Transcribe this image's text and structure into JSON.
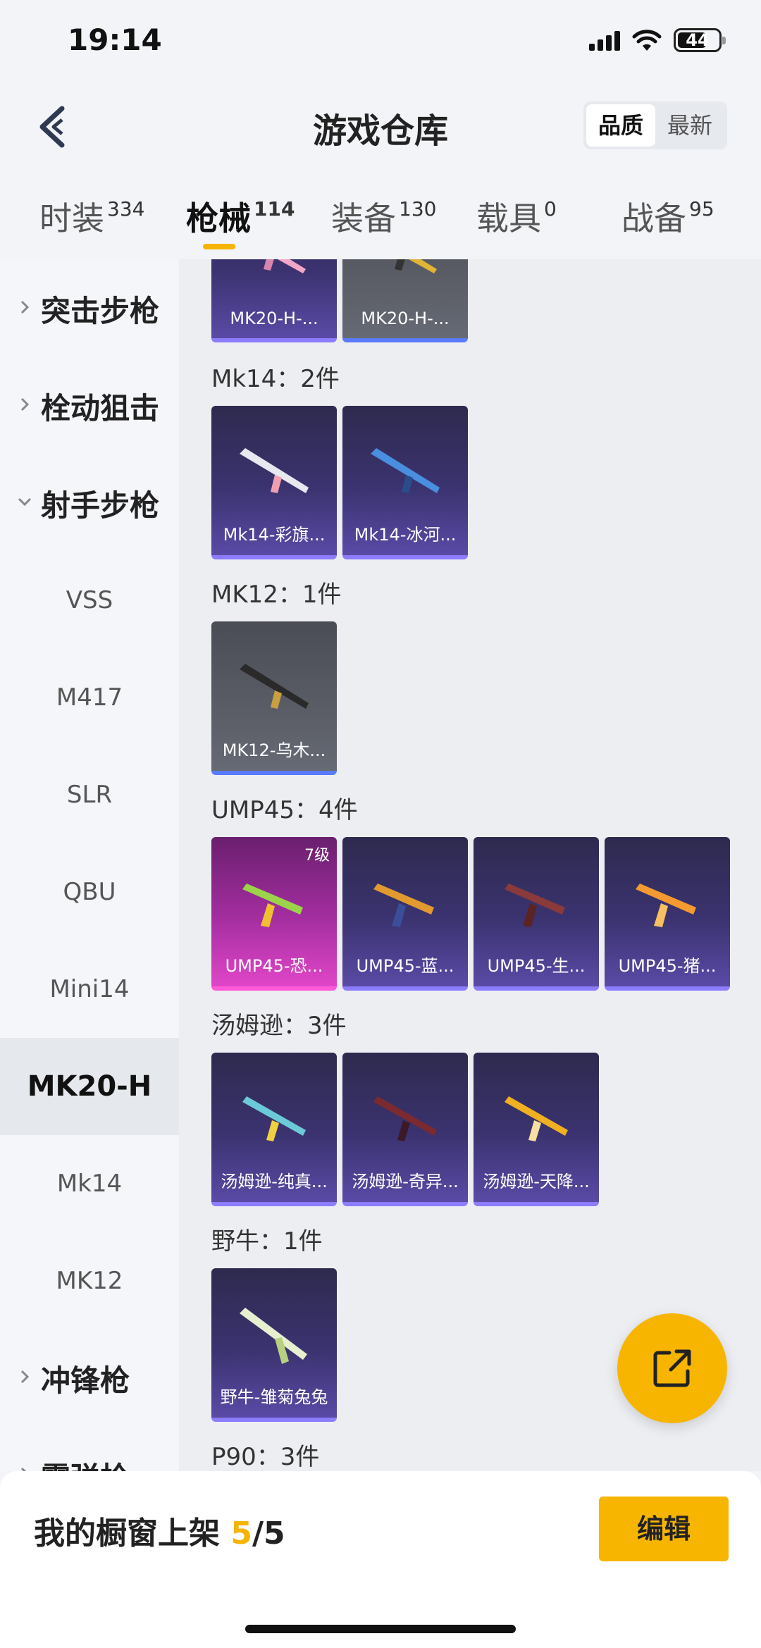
{
  "status_bar": {
    "time": "19:14",
    "battery": "44"
  },
  "header": {
    "title": "游戏仓库",
    "sort_options": [
      "品质",
      "最新"
    ],
    "sort_selected": "品质"
  },
  "tabs": [
    {
      "label": "时装",
      "count": "334"
    },
    {
      "label": "枪械",
      "count": "114"
    },
    {
      "label": "装备",
      "count": "130"
    },
    {
      "label": "载具",
      "count": "0"
    },
    {
      "label": "战备",
      "count": "95"
    }
  ],
  "active_tab": "枪械",
  "sidebar": {
    "groups": {
      "assault": "突击步枪",
      "bolt": "栓动狙击",
      "marksman": "射手步枪",
      "smg": "冲锋枪",
      "shotgun": "霰弹枪"
    },
    "marksman_items": [
      "VSS",
      "M417",
      "SLR",
      "QBU",
      "Mini14",
      "MK20-H",
      "Mk14",
      "MK12"
    ],
    "selected": "MK20-H"
  },
  "sections": {
    "mk20_cards": [
      "MK20-H-...",
      "MK20-H-..."
    ],
    "mk14": {
      "label": "Mk14：2件",
      "cards": [
        "Mk14-彩旗...",
        "Mk14-冰河..."
      ]
    },
    "mk12": {
      "label": "MK12：1件",
      "cards": [
        "MK12-乌木..."
      ]
    },
    "ump45": {
      "label": "UMP45：4件",
      "level": "7级",
      "cards": [
        "UMP45-恐...",
        "UMP45-蓝...",
        "UMP45-生...",
        "UMP45-猪..."
      ]
    },
    "thompson": {
      "label": "汤姆逊：3件",
      "cards": [
        "汤姆逊-纯真...",
        "汤姆逊-奇异...",
        "汤姆逊-天降..."
      ]
    },
    "bison": {
      "label": "野牛：1件",
      "cards": [
        "野牛-雏菊兔兔"
      ]
    },
    "p90": {
      "label": "P90：3件"
    }
  },
  "bottom": {
    "label": "我的橱窗上架",
    "count": "5",
    "total": "/5",
    "edit": "编辑"
  },
  "colors": {
    "accent": "#f5b400",
    "card_purple": "#3b3370",
    "card_pink": "#e046c8"
  }
}
